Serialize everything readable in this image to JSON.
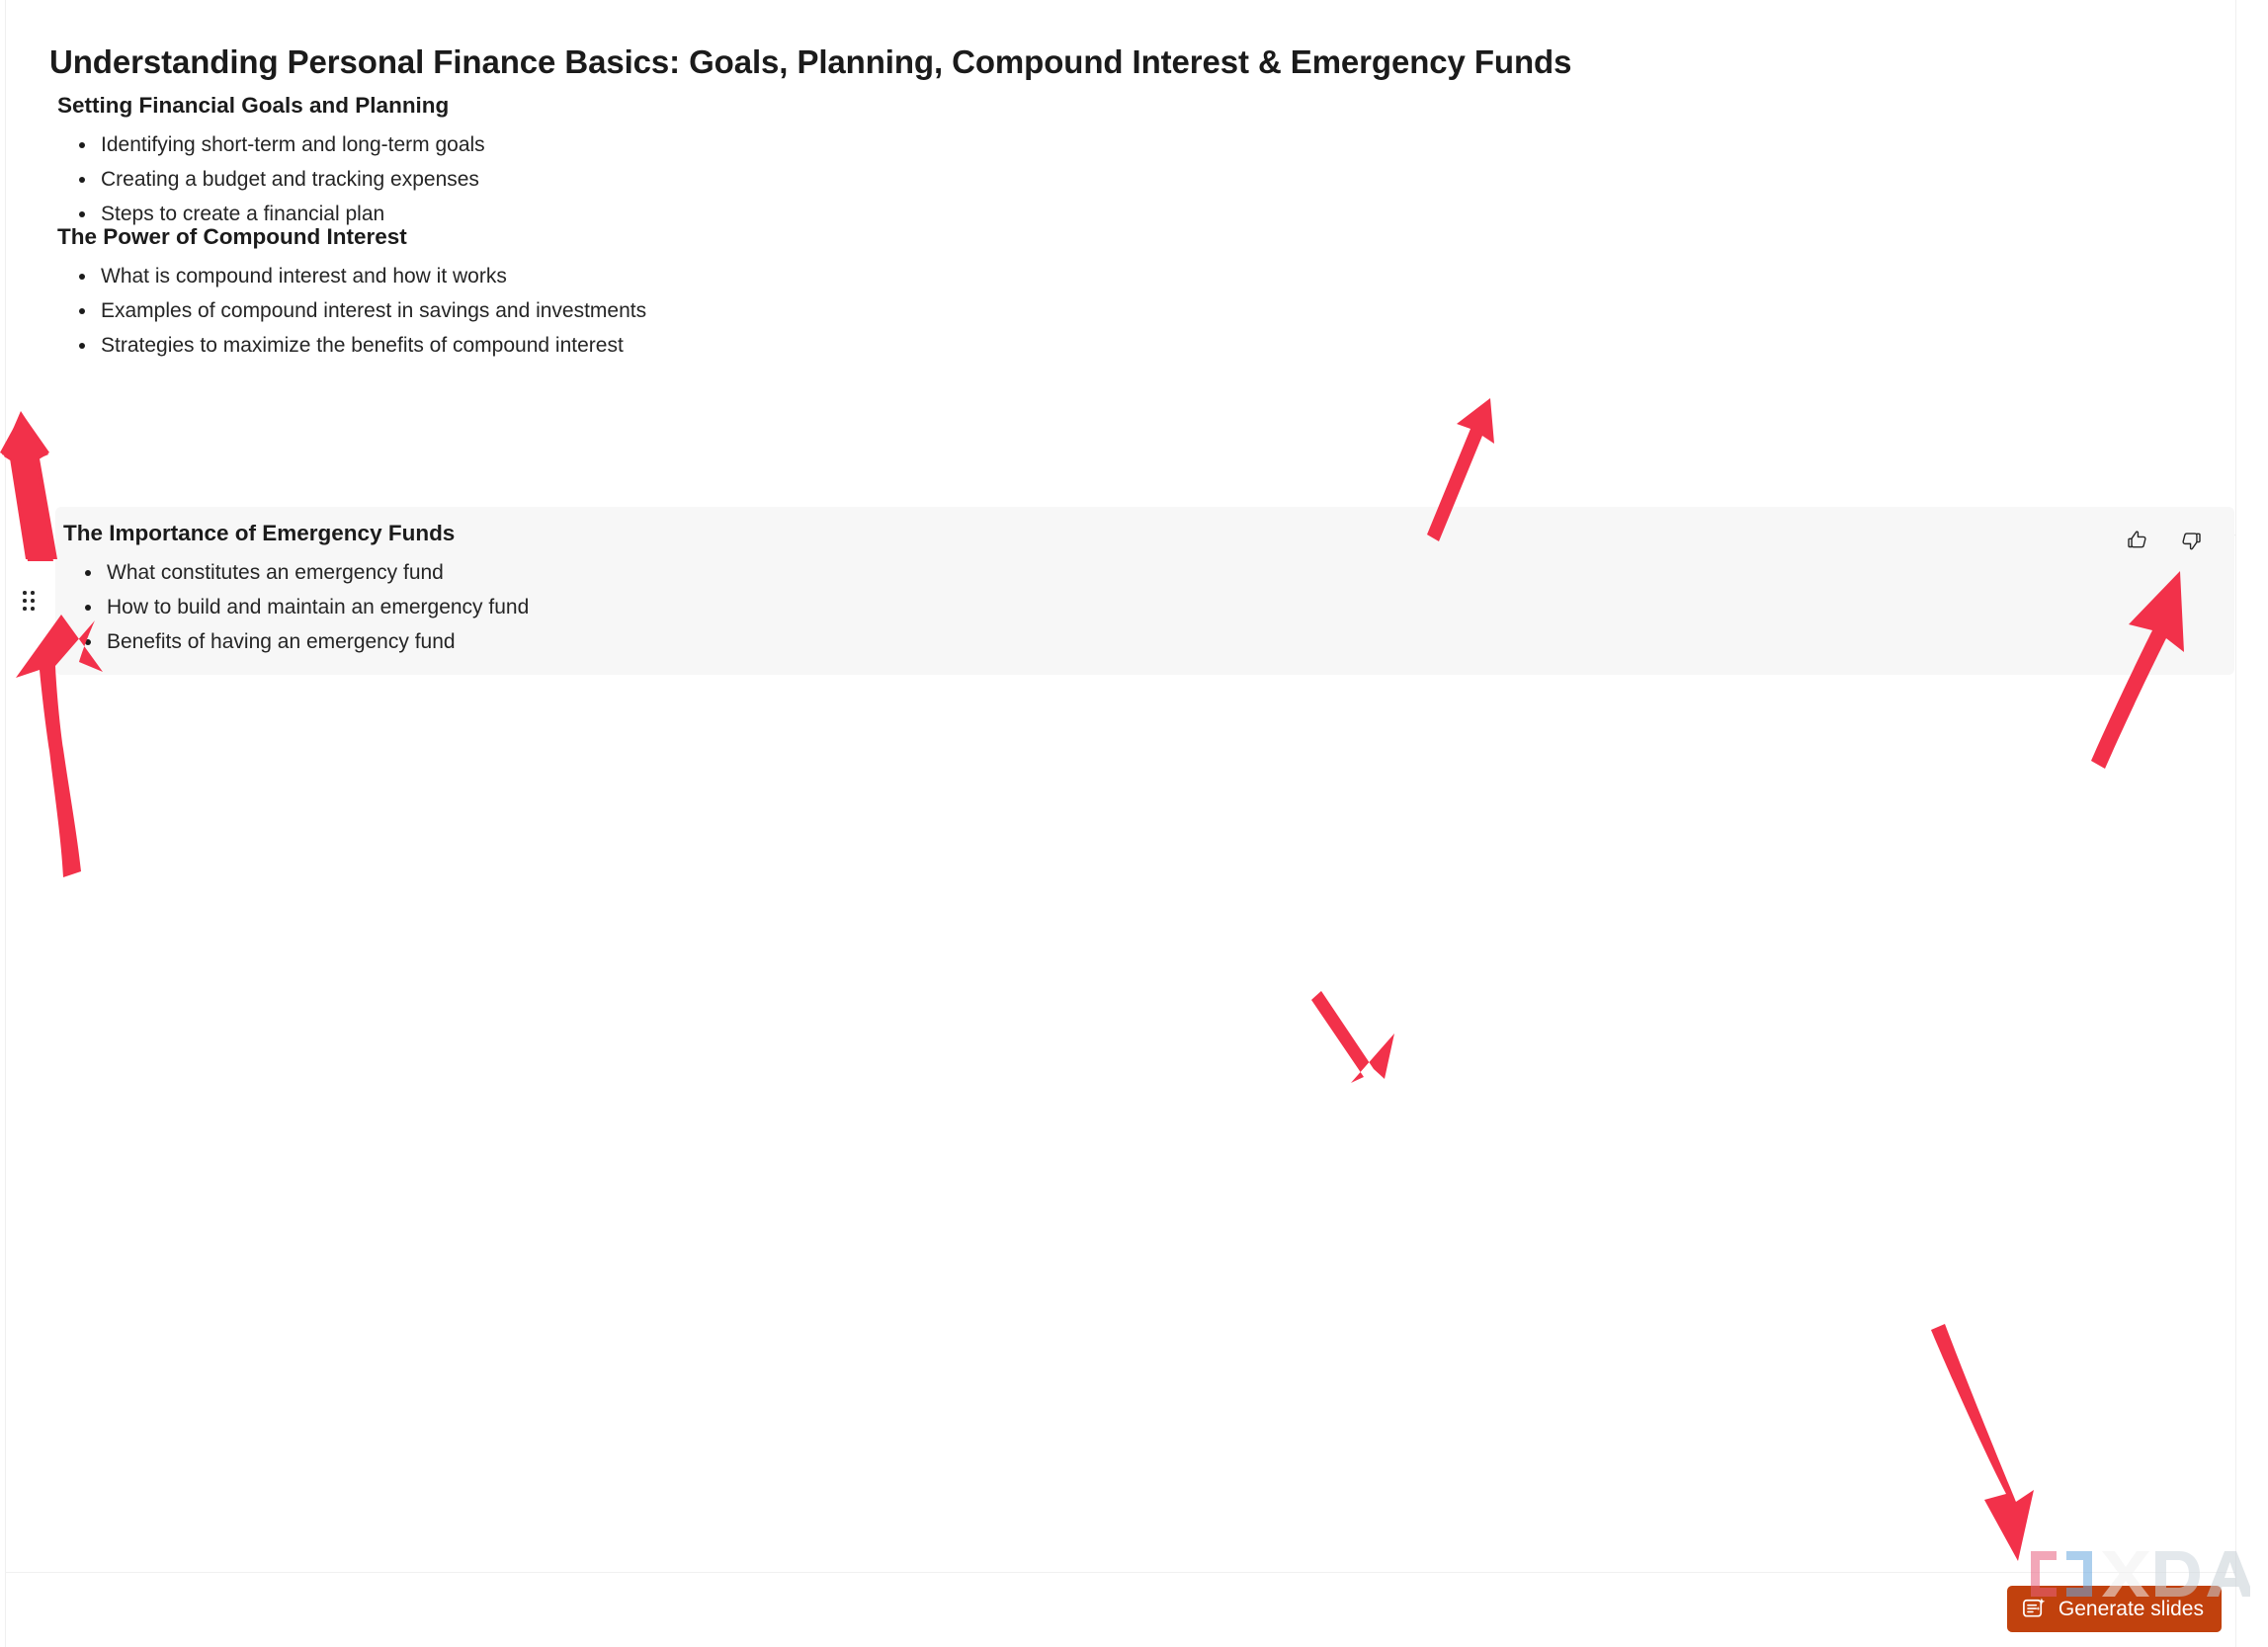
{
  "app": {
    "accent_button_color": "#c1410d",
    "annotation_arrow_color": "#f2314a",
    "highlight_background": "#f7f7f7"
  },
  "outline": {
    "title": "Understanding Personal Finance Basics: Goals, Planning, Compound Interest & Emergency Funds",
    "sections": [
      {
        "heading": "Setting Financial Goals and Planning",
        "bullets": [
          "Identifying short-term and long-term goals",
          "Creating a budget and tracking expenses",
          "Steps to create a financial plan"
        ],
        "highlighted": false
      },
      {
        "heading": "The Power of Compound Interest",
        "bullets": [
          "What is compound interest and how it works",
          "Examples of compound interest in savings and investments",
          "Strategies to maximize the benefits of compound interest"
        ],
        "highlighted": false
      },
      {
        "heading": "The Importance of Emergency Funds",
        "bullets": [
          "What constitutes an emergency fund",
          "How to build and maintain an emergency fund",
          "Benefits of having an emergency fund"
        ],
        "highlighted": true
      }
    ]
  },
  "section_actions": {
    "thumbs_up_icon": "thumbs-up-icon",
    "thumbs_down_icon": "thumbs-down-icon",
    "delete_icon": "trash-icon"
  },
  "drag_handle": {
    "icon": "drag-dots-icon"
  },
  "bottom_bar": {
    "generate_slides_label": "Generate slides",
    "generate_slides_icon": "generate-document-sparkle-icon"
  },
  "watermark": {
    "text": "XDA"
  },
  "annotations": {
    "arrows": [
      {
        "name": "arrow-to-drag-handle",
        "points_to": "drag-handle"
      },
      {
        "name": "arrow-to-delete-icon",
        "points_to": "trash-icon"
      },
      {
        "name": "arrow-to-generate-slides",
        "points_to": "generate-slides-button"
      }
    ]
  }
}
